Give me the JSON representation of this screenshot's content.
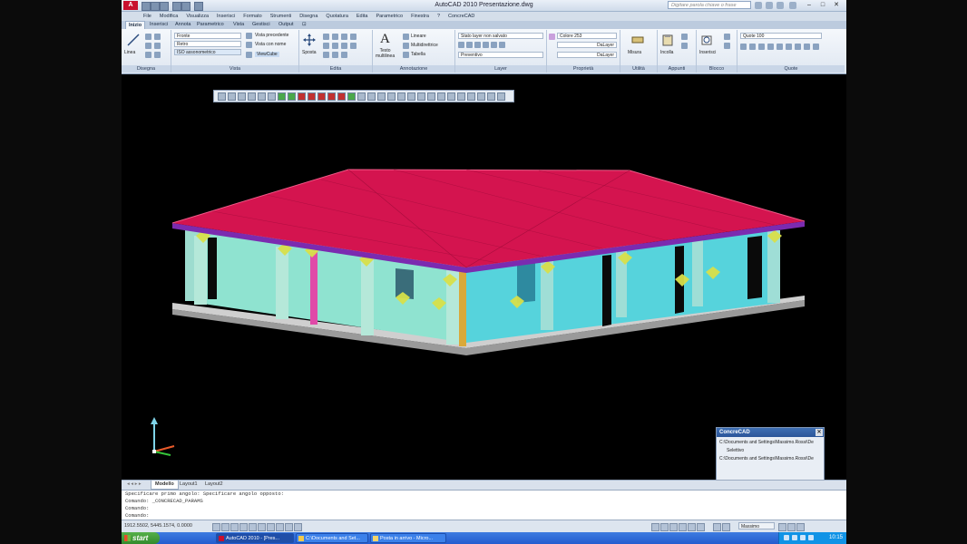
{
  "window": {
    "title": "AutoCAD 2010    Presentazione.dwg",
    "logo": "A",
    "search_placeholder": "Digitare parola chiave o frase",
    "controls": [
      "–",
      "□",
      "✕"
    ]
  },
  "menu": [
    "File",
    "Modifica",
    "Visualizza",
    "Inserisci",
    "Formato",
    "Strumenti",
    "Disegna",
    "Quotatura",
    "Edita",
    "Parametrico",
    "Finestra",
    "?",
    "ConcreCAD"
  ],
  "tabs": [
    "Inizio",
    "Inserisci",
    "Annota",
    "Parametrico",
    "Vista",
    "Gestisci",
    "Output",
    "⊡"
  ],
  "ribbon": {
    "disegna": {
      "title": "Disegna",
      "linea": "Linea"
    },
    "vista": {
      "title": "Vista",
      "view_options": [
        "Fronte",
        "Retro",
        "ISO sudovest"
      ],
      "view_iso": "ISO assonometrico",
      "vista_precedente": "Vista precedente",
      "vista_con_nome": "Vista con nome",
      "viewcube": "ViewCube"
    },
    "edita": {
      "title": "Edita",
      "sposta": "Sposta"
    },
    "annotazione": {
      "title": "Annotazione",
      "testo": "Testo\nmultilinea",
      "lineare": "Lineare",
      "multidirettrice": "Multidirettrice",
      "tabella": "Tabella"
    },
    "layer": {
      "title": "Layer",
      "stato": "Stato layer non salvato",
      "corrente": "Preventivo"
    },
    "proprieta": {
      "title": "Proprietà",
      "colore": "Colore 253",
      "linetype": "DaLayer",
      "lineweight": "DaLayer"
    },
    "utilita": {
      "title": "Utilità",
      "misura": "Misura"
    },
    "appunti": {
      "title": "Appunti",
      "incolla": "Incolla"
    },
    "blocco": {
      "title": "Blocco",
      "inserisci": "Inserisci"
    },
    "quote": {
      "title": "Quote",
      "scala": "Quote 100"
    }
  },
  "palette": {
    "title": "ConcreCAD",
    "rows": [
      "C:\\Documents and Settings\\Massimo.Rossi\\De",
      "Selettivo",
      "C:\\Documents and Settings\\Massimo.Rossi\\De"
    ]
  },
  "layout_tabs": [
    "Modello",
    "Layout1",
    "Layout2"
  ],
  "command": {
    "lines": [
      "Specificare primo angolo: Specificare angolo opposto:",
      "Comando:  _CONCRECAD_PARAMS",
      "Comando:",
      "Comando:"
    ]
  },
  "status": {
    "coords": "1912.5502, 5445.1574, 0.0000",
    "workspace": "Massimo"
  },
  "taskbar": {
    "start": "start",
    "tasks": [
      "AutoCAD 2010 - [Pres...",
      "C:\\Documents and Set...",
      "Posta in arrivo - Micro..."
    ],
    "clock": "10:15"
  },
  "colors": {
    "roof": "#d4144f",
    "wall": "#8fe0cc",
    "slab": "#bfbfbf",
    "highlight": "#d8e04a",
    "background": "#000000"
  }
}
